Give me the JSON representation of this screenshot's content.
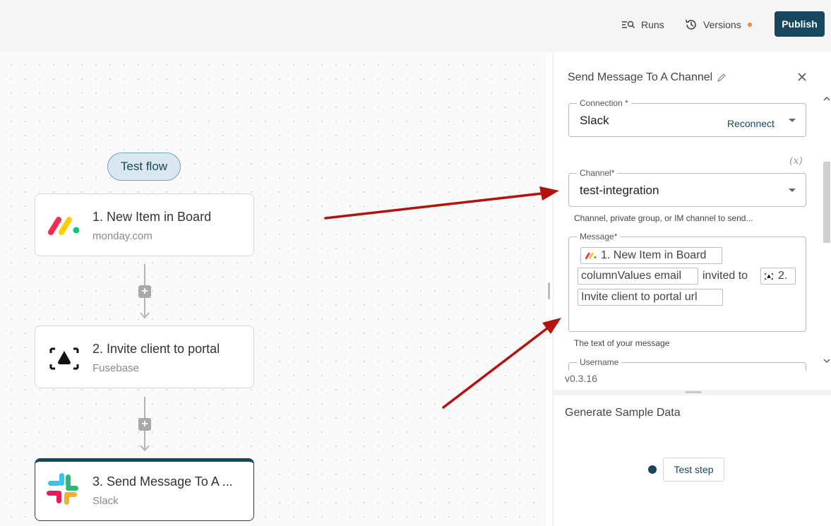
{
  "header": {
    "runs_label": "Runs",
    "versions_label": "Versions",
    "publish_label": "Publish"
  },
  "canvas": {
    "test_flow_label": "Test flow",
    "steps": [
      {
        "title": "1. New Item in Board",
        "app": "monday.com"
      },
      {
        "title": "2. Invite client to portal",
        "app": "Fusebase"
      },
      {
        "title": "3. Send Message To A ...",
        "app": "Slack"
      }
    ],
    "add_glyph": "+"
  },
  "panel": {
    "title": "Send Message To A Channel",
    "connection": {
      "label": "Connection *",
      "value": "Slack",
      "action": "Reconnect"
    },
    "var_toggle": "(x)",
    "channel": {
      "label": "Channel*",
      "value": "test-integration",
      "help": "Channel, private group, or IM channel to send..."
    },
    "message": {
      "label": "Message*",
      "chip1": "1. New Item in Board",
      "chip2": "columnValues email",
      "text": "invited to",
      "chip3": "2.",
      "chip4": "Invite client to portal url",
      "help": "The text of your message"
    },
    "username_label": "Username",
    "version": "v0.3.16"
  },
  "sample": {
    "title": "Generate Sample Data",
    "test_step_label": "Test step"
  },
  "colors": {
    "primary": "#17475e",
    "annotation_arrow": "#b3120d",
    "versions_dot": "#f08a38"
  }
}
